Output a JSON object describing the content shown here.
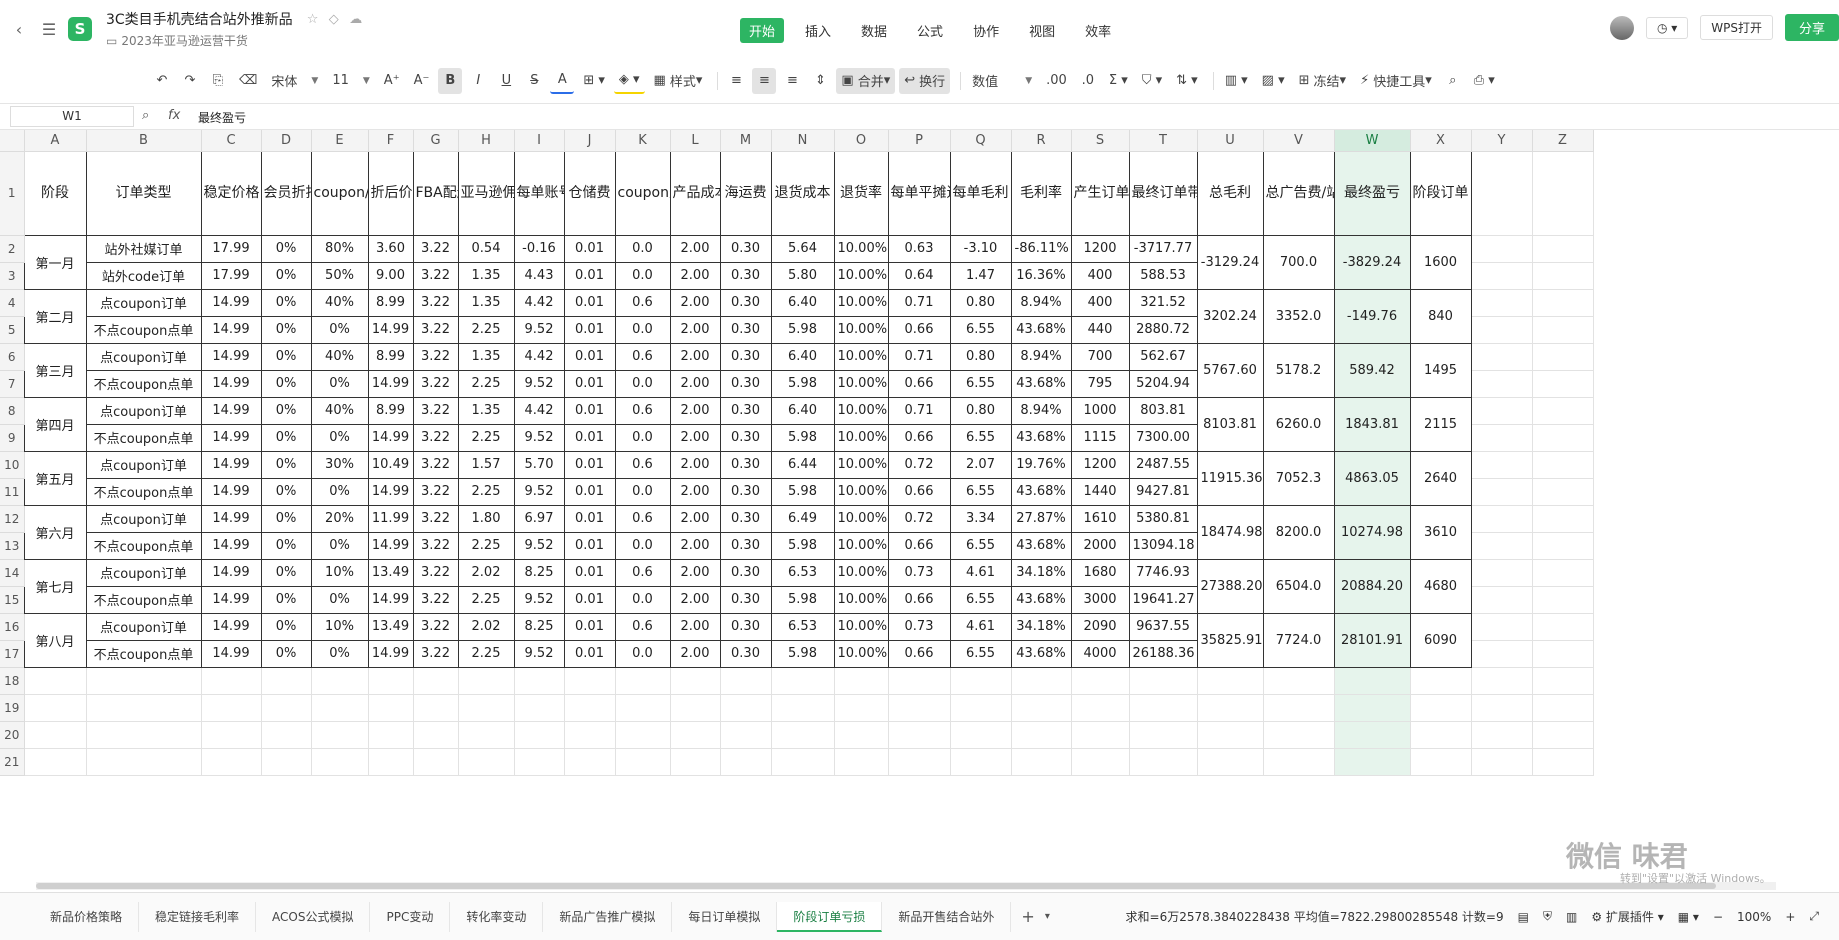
{
  "doc": {
    "title": "3C类目手机壳结合站外推新品",
    "subtitle": "2023年亚马逊运营干货",
    "logo": "S"
  },
  "menu": [
    "开始",
    "插入",
    "数据",
    "公式",
    "协作",
    "视图",
    "效率"
  ],
  "menu_active": 0,
  "header_right": {
    "wps_open": "WPS打开",
    "share": "分享"
  },
  "toolbar": {
    "font": "宋体",
    "font_size": "11",
    "style": "样式",
    "merge": "合并",
    "wrap": "换行",
    "number_format": "数值",
    "freeze": "冻结",
    "quick_tools": "快捷工具"
  },
  "formula": {
    "cell": "W1",
    "fx": "fx",
    "content": "最终盈亏"
  },
  "columns": [
    "A",
    "B",
    "C",
    "D",
    "E",
    "F",
    "G",
    "H",
    "I",
    "J",
    "K",
    "L",
    "M",
    "N",
    "O",
    "P",
    "Q",
    "R",
    "S",
    "T",
    "U",
    "V",
    "W",
    "X",
    "Y",
    "Z"
  ],
  "headers": [
    "阶段",
    "订单类型",
    "稳定价格",
    "会员折扣/秒杀",
    "coupon/code",
    "折后价",
    "FBA配送费",
    "亚马逊佣金",
    "每单账号回款",
    "仓储费",
    "coupon费用",
    "产品成本",
    "海运费",
    "退货成本",
    "退货率",
    "每单平摊退货成本",
    "每单毛利",
    "毛利率",
    "产生订单数量",
    "最终订单带来毛利",
    "总毛利",
    "总广告费/站外费用",
    "最终盈亏",
    "阶段订单"
  ],
  "rows": [
    [
      "站外社媒订单",
      "17.99",
      "0%",
      "80%",
      "3.60",
      "3.22",
      "0.54",
      "-0.16",
      "0.01",
      "0.0",
      "2.00",
      "0.30",
      "5.64",
      "10.00%",
      "0.63",
      "-3.10",
      "-86.11%",
      "1200",
      "-3717.77"
    ],
    [
      "站外code订单",
      "17.99",
      "0%",
      "50%",
      "9.00",
      "3.22",
      "1.35",
      "4.43",
      "0.01",
      "0.0",
      "2.00",
      "0.30",
      "5.80",
      "10.00%",
      "0.64",
      "1.47",
      "16.36%",
      "400",
      "588.53"
    ],
    [
      "点coupon订单",
      "14.99",
      "0%",
      "40%",
      "8.99",
      "3.22",
      "1.35",
      "4.42",
      "0.01",
      "0.6",
      "2.00",
      "0.30",
      "6.40",
      "10.00%",
      "0.71",
      "0.80",
      "8.94%",
      "400",
      "321.52"
    ],
    [
      "不点coupon点单",
      "14.99",
      "0%",
      "0%",
      "14.99",
      "3.22",
      "2.25",
      "9.52",
      "0.01",
      "0.0",
      "2.00",
      "0.30",
      "5.98",
      "10.00%",
      "0.66",
      "6.55",
      "43.68%",
      "440",
      "2880.72"
    ],
    [
      "点coupon订单",
      "14.99",
      "0%",
      "40%",
      "8.99",
      "3.22",
      "1.35",
      "4.42",
      "0.01",
      "0.6",
      "2.00",
      "0.30",
      "6.40",
      "10.00%",
      "0.71",
      "0.80",
      "8.94%",
      "700",
      "562.67"
    ],
    [
      "不点coupon点单",
      "14.99",
      "0%",
      "0%",
      "14.99",
      "3.22",
      "2.25",
      "9.52",
      "0.01",
      "0.0",
      "2.00",
      "0.30",
      "5.98",
      "10.00%",
      "0.66",
      "6.55",
      "43.68%",
      "795",
      "5204.94"
    ],
    [
      "点coupon订单",
      "14.99",
      "0%",
      "40%",
      "8.99",
      "3.22",
      "1.35",
      "4.42",
      "0.01",
      "0.6",
      "2.00",
      "0.30",
      "6.40",
      "10.00%",
      "0.71",
      "0.80",
      "8.94%",
      "1000",
      "803.81"
    ],
    [
      "不点coupon点单",
      "14.99",
      "0%",
      "0%",
      "14.99",
      "3.22",
      "2.25",
      "9.52",
      "0.01",
      "0.0",
      "2.00",
      "0.30",
      "5.98",
      "10.00%",
      "0.66",
      "6.55",
      "43.68%",
      "1115",
      "7300.00"
    ],
    [
      "点coupon订单",
      "14.99",
      "0%",
      "30%",
      "10.49",
      "3.22",
      "1.57",
      "5.70",
      "0.01",
      "0.6",
      "2.00",
      "0.30",
      "6.44",
      "10.00%",
      "0.72",
      "2.07",
      "19.76%",
      "1200",
      "2487.55"
    ],
    [
      "不点coupon点单",
      "14.99",
      "0%",
      "0%",
      "14.99",
      "3.22",
      "2.25",
      "9.52",
      "0.01",
      "0.0",
      "2.00",
      "0.30",
      "5.98",
      "10.00%",
      "0.66",
      "6.55",
      "43.68%",
      "1440",
      "9427.81"
    ],
    [
      "点coupon订单",
      "14.99",
      "0%",
      "20%",
      "11.99",
      "3.22",
      "1.80",
      "6.97",
      "0.01",
      "0.6",
      "2.00",
      "0.30",
      "6.49",
      "10.00%",
      "0.72",
      "3.34",
      "27.87%",
      "1610",
      "5380.81"
    ],
    [
      "不点coupon点单",
      "14.99",
      "0%",
      "0%",
      "14.99",
      "3.22",
      "2.25",
      "9.52",
      "0.01",
      "0.0",
      "2.00",
      "0.30",
      "5.98",
      "10.00%",
      "0.66",
      "6.55",
      "43.68%",
      "2000",
      "13094.18"
    ],
    [
      "点coupon订单",
      "14.99",
      "0%",
      "10%",
      "13.49",
      "3.22",
      "2.02",
      "8.25",
      "0.01",
      "0.6",
      "2.00",
      "0.30",
      "6.53",
      "10.00%",
      "0.73",
      "4.61",
      "34.18%",
      "1680",
      "7746.93"
    ],
    [
      "不点coupon点单",
      "14.99",
      "0%",
      "0%",
      "14.99",
      "3.22",
      "2.25",
      "9.52",
      "0.01",
      "0.0",
      "2.00",
      "0.30",
      "5.98",
      "10.00%",
      "0.66",
      "6.55",
      "43.68%",
      "3000",
      "19641.27"
    ],
    [
      "点coupon订单",
      "14.99",
      "0%",
      "10%",
      "13.49",
      "3.22",
      "2.02",
      "8.25",
      "0.01",
      "0.6",
      "2.00",
      "0.30",
      "6.53",
      "10.00%",
      "0.73",
      "4.61",
      "34.18%",
      "2090",
      "9637.55"
    ],
    [
      "不点coupon点单",
      "14.99",
      "0%",
      "0%",
      "14.99",
      "3.22",
      "2.25",
      "9.52",
      "0.01",
      "0.0",
      "2.00",
      "0.30",
      "5.98",
      "10.00%",
      "0.66",
      "6.55",
      "43.68%",
      "4000",
      "26188.36"
    ]
  ],
  "stages": [
    {
      "name": "第一月",
      "total": "-3129.24",
      "ad": "700.0",
      "pl": "-3829.24",
      "orders": "1600"
    },
    {
      "name": "第二月",
      "total": "3202.24",
      "ad": "3352.0",
      "pl": "-149.76",
      "orders": "840"
    },
    {
      "name": "第三月",
      "total": "5767.60",
      "ad": "5178.2",
      "pl": "589.42",
      "orders": "1495"
    },
    {
      "name": "第四月",
      "total": "8103.81",
      "ad": "6260.0",
      "pl": "1843.81",
      "orders": "2115"
    },
    {
      "name": "第五月",
      "total": "11915.36",
      "ad": "7052.3",
      "pl": "4863.05",
      "orders": "2640"
    },
    {
      "name": "第六月",
      "total": "18474.98",
      "ad": "8200.0",
      "pl": "10274.98",
      "orders": "3610"
    },
    {
      "name": "第七月",
      "total": "27388.20",
      "ad": "6504.0",
      "pl": "20884.20",
      "orders": "4680"
    },
    {
      "name": "第八月",
      "total": "35825.91",
      "ad": "7724.0",
      "pl": "28101.91",
      "orders": "6090"
    }
  ],
  "empty_rows": [
    "18",
    "19",
    "20",
    "21"
  ],
  "sheets": [
    "新品价格策略",
    "稳定链接毛利率",
    "ACOS公式模拟",
    "PPC变动",
    "转化率变动",
    "新品广告推广模拟",
    "每日订单模拟",
    "阶段订单亏损",
    "新品开售结合站外"
  ],
  "active_sheet": 7,
  "status": {
    "summary": "求和=6万2578.3840228438  平均值=7822.29800285548  计数=9",
    "plugins": "扩展插件",
    "zoom": "100%"
  },
  "watermark": {
    "text": "微信 味君",
    "note": "转到\"设置\"以激活 Windows。"
  }
}
